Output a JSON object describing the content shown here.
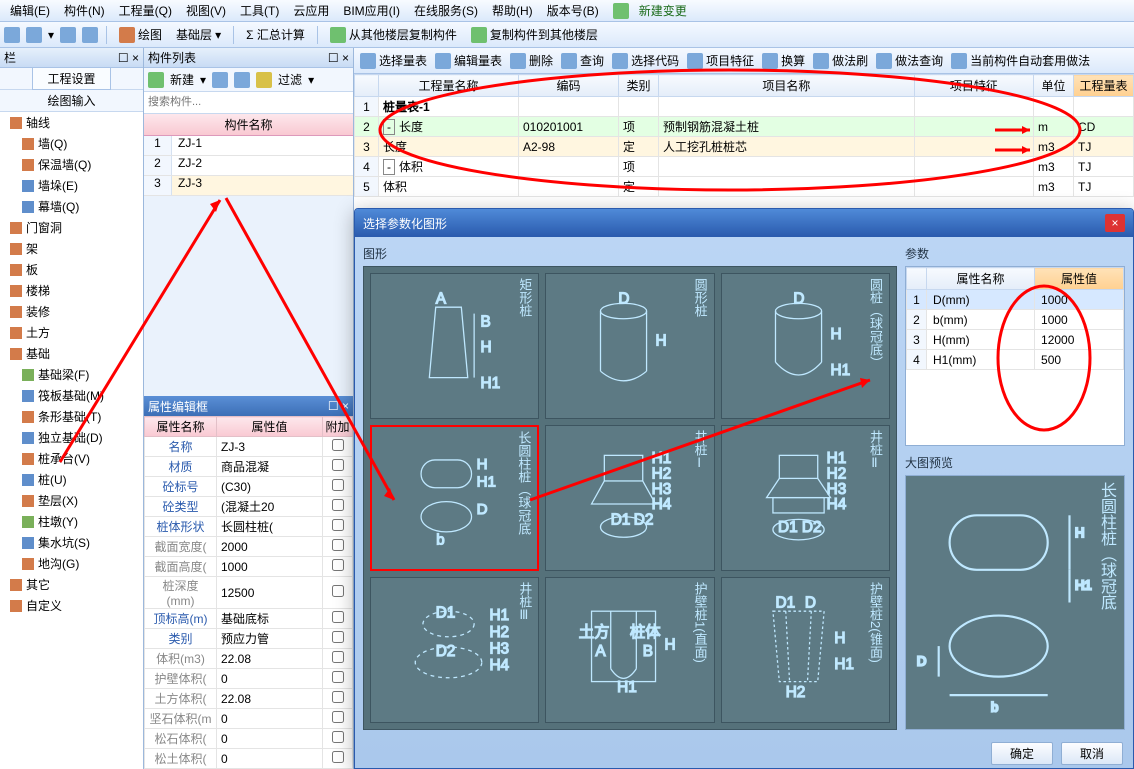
{
  "menu": [
    "编辑(E)",
    "构件(N)",
    "工程量(Q)",
    "视图(V)",
    "工具(T)",
    "云应用",
    "BIM应用(I)",
    "在线服务(S)",
    "帮助(H)",
    "版本号(B)"
  ],
  "menu_newchange": "新建变更",
  "toolbar": {
    "draw": "绘图",
    "layer": "基础层",
    "sigma": "Σ 汇总计算",
    "copy1": "从其他楼层复制构件",
    "copy2": "复制构件到其他楼层"
  },
  "leftpanel": {
    "title": "栏",
    "settings": "工程设置",
    "drawinput": "绘图输入",
    "tree": [
      {
        "l": "轴线",
        "c": "r"
      },
      {
        "l": "墙(Q)",
        "c": "r",
        "sub": true
      },
      {
        "l": "保温墙(Q)",
        "c": "r",
        "sub": true
      },
      {
        "l": "墙垛(E)",
        "c": "b",
        "sub": true
      },
      {
        "l": "幕墙(Q)",
        "c": "b",
        "sub": true
      },
      {
        "l": "门窗洞",
        "c": "r"
      },
      {
        "l": "架",
        "c": "r"
      },
      {
        "l": "板",
        "c": "r"
      },
      {
        "l": "楼梯",
        "c": "r"
      },
      {
        "l": "装修",
        "c": "r"
      },
      {
        "l": "土方",
        "c": "r"
      },
      {
        "l": "基础",
        "c": "r"
      },
      {
        "l": "基础梁(F)",
        "c": "g",
        "sub": true
      },
      {
        "l": "筏板基础(M)",
        "c": "b",
        "sub": true
      },
      {
        "l": "条形基础(T)",
        "c": "r",
        "sub": true
      },
      {
        "l": "独立基础(D)",
        "c": "b",
        "sub": true
      },
      {
        "l": "桩承台(V)",
        "c": "r",
        "sub": true
      },
      {
        "l": "桩(U)",
        "c": "b",
        "sub": true
      },
      {
        "l": "垫层(X)",
        "c": "r",
        "sub": true
      },
      {
        "l": "柱墩(Y)",
        "c": "g",
        "sub": true
      },
      {
        "l": "集水坑(S)",
        "c": "b",
        "sub": true
      },
      {
        "l": "地沟(G)",
        "c": "r",
        "sub": true
      },
      {
        "l": "其它",
        "c": "r"
      },
      {
        "l": "自定义",
        "c": "r"
      }
    ]
  },
  "midpanel": {
    "title": "构件列表",
    "new": "新建",
    "filter": "过滤",
    "search_ph": "搜索构件...",
    "hdr": "构件名称",
    "rows": [
      {
        "n": "1",
        "v": "ZJ-1"
      },
      {
        "n": "2",
        "v": "ZJ-2"
      },
      {
        "n": "3",
        "v": "ZJ-3",
        "sel": true
      }
    ]
  },
  "propedit": {
    "title": "属性编辑框",
    "h1": "属性名称",
    "h2": "属性值",
    "h3": "附加",
    "rows": [
      {
        "l": "名称",
        "v": "ZJ-3"
      },
      {
        "l": "材质",
        "v": "商品混凝"
      },
      {
        "l": "砼标号",
        "v": "(C30)"
      },
      {
        "l": "砼类型",
        "v": "(混凝土20"
      },
      {
        "l": "桩体形状",
        "v": "长圆柱桩("
      },
      {
        "l": "截面宽度(",
        "v": "2000",
        "g": true
      },
      {
        "l": "截面高度(",
        "v": "1000",
        "g": true
      },
      {
        "l": "桩深度(mm)",
        "v": "12500",
        "g": true
      },
      {
        "l": "顶标高(m)",
        "v": "基础底标"
      },
      {
        "l": "类别",
        "v": "预应力管"
      },
      {
        "l": "体积(m3)",
        "v": "22.08",
        "g": true
      },
      {
        "l": "护壁体积(",
        "v": "0",
        "g": true
      },
      {
        "l": "土方体积(",
        "v": "22.08",
        "g": true
      },
      {
        "l": "坚石体积(m",
        "v": "0",
        "g": true
      },
      {
        "l": "松石体积(",
        "v": "0",
        "g": true
      },
      {
        "l": "松土体积(",
        "v": "0",
        "g": true
      }
    ]
  },
  "rtoolbar": [
    "选择量表",
    "编辑量表",
    "删除",
    "查询",
    "选择代码",
    "项目特征",
    "换算",
    "做法刷",
    "做法查询",
    "当前构件自动套用做法"
  ],
  "qtygrid": {
    "hdrs": [
      "",
      "工程量名称",
      "编码",
      "类别",
      "项目名称",
      "项目特征",
      "单位",
      "工程量表"
    ],
    "rows": [
      {
        "n": "1",
        "name": "桩量表-1",
        "bold": true
      },
      {
        "n": "2",
        "exp": "-",
        "name": "长度",
        "code": "010201001",
        "cat": "项",
        "pname": "预制钢筋混凝土桩",
        "unit": "m",
        "qty": "CD",
        "cls": "green"
      },
      {
        "n": "3",
        "name": "长度",
        "code": "A2-98",
        "cat": "定",
        "pname": "人工挖孔桩桩芯",
        "unit": "m3",
        "qty": "TJ",
        "cls": "yel"
      },
      {
        "n": "4",
        "exp": "-",
        "name": "体积",
        "cat": "项",
        "unit": "m3",
        "qty": "TJ"
      },
      {
        "n": "5",
        "name": "体积",
        "cat": "定",
        "unit": "m3",
        "qty": "TJ"
      }
    ]
  },
  "modal": {
    "title": "选择参数化图形",
    "shapes_label": "图形",
    "params_label": "参数",
    "preview_label": "大图预览",
    "shapes": [
      "矩形桩",
      "圆形桩",
      "圆桩︵球冠底︶",
      "长圆柱桩︵球冠底",
      "井桩Ⅰ",
      "井桩Ⅱ",
      "井桩Ⅲ",
      "护壁桩1(直面)",
      "护壁桩2(锥面)"
    ],
    "param_hdr": [
      "属性名称",
      "属性值"
    ],
    "params": [
      {
        "n": "1",
        "k": "D(mm)",
        "v": "1000",
        "sel": true
      },
      {
        "n": "2",
        "k": "b(mm)",
        "v": "1000"
      },
      {
        "n": "3",
        "k": "H(mm)",
        "v": "12000"
      },
      {
        "n": "4",
        "k": "H1(mm)",
        "v": "500"
      }
    ],
    "preview_label_cn": "长圆柱桩︵球冠底",
    "ok": "确定",
    "cancel": "取消"
  }
}
